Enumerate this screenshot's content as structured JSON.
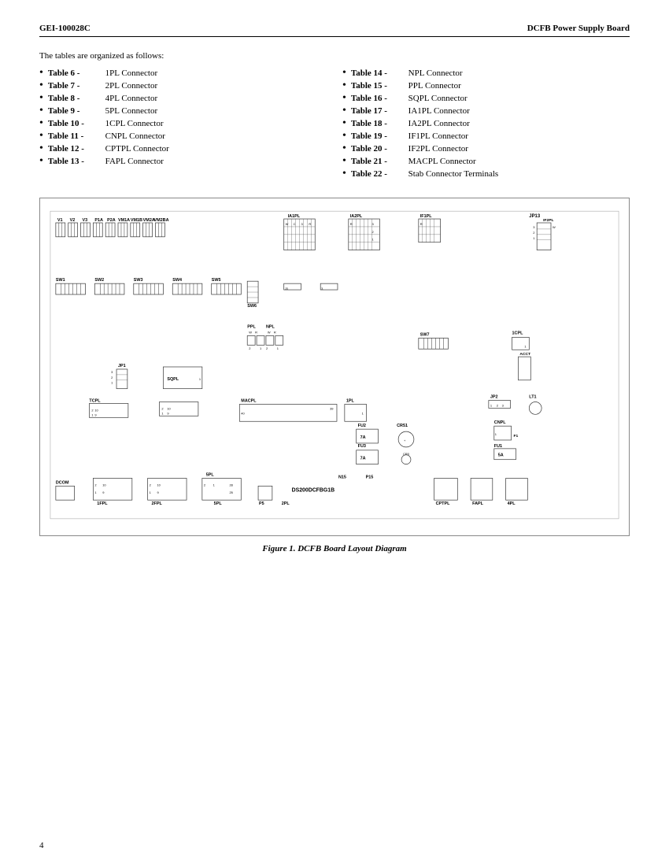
{
  "header": {
    "left": "GEI-100028C",
    "right": "DCFB Power Supply Board"
  },
  "intro": "The tables are organized as follows:",
  "tables_left": [
    {
      "ref": "Table 6 -",
      "desc": "1PL Connector"
    },
    {
      "ref": "Table 7 -",
      "desc": "2PL Connector"
    },
    {
      "ref": "Table 8 -",
      "desc": "4PL Connector"
    },
    {
      "ref": "Table 9 -",
      "desc": "5PL Connector"
    },
    {
      "ref": "Table 10 -",
      "desc": "1CPL Connector"
    },
    {
      "ref": "Table 11 -",
      "desc": "CNPL Connector"
    },
    {
      "ref": "Table 12 -",
      "desc": "CPTPL Connector"
    },
    {
      "ref": "Table 13 -",
      "desc": "FAPL Connector"
    }
  ],
  "tables_right": [
    {
      "ref": "Table 14 -",
      "desc": "NPL Connector"
    },
    {
      "ref": "Table 15 -",
      "desc": "PPL Connector"
    },
    {
      "ref": "Table 16 -",
      "desc": "SQPL Connector"
    },
    {
      "ref": "Table 17 -",
      "desc": "IA1PL Connector"
    },
    {
      "ref": "Table 18 -",
      "desc": "IA2PL Connector"
    },
    {
      "ref": "Table 19 -",
      "desc": "IF1PL Connector"
    },
    {
      "ref": "Table 20 -",
      "desc": "IF2PL Connector"
    },
    {
      "ref": "Table 21 -",
      "desc": "MACPL Connector"
    },
    {
      "ref": "Table 22 -",
      "desc": "Stab Connector Terminals"
    }
  ],
  "figure_caption": "Figure 1.  DCFB Board Layout Diagram",
  "page_number": "4"
}
